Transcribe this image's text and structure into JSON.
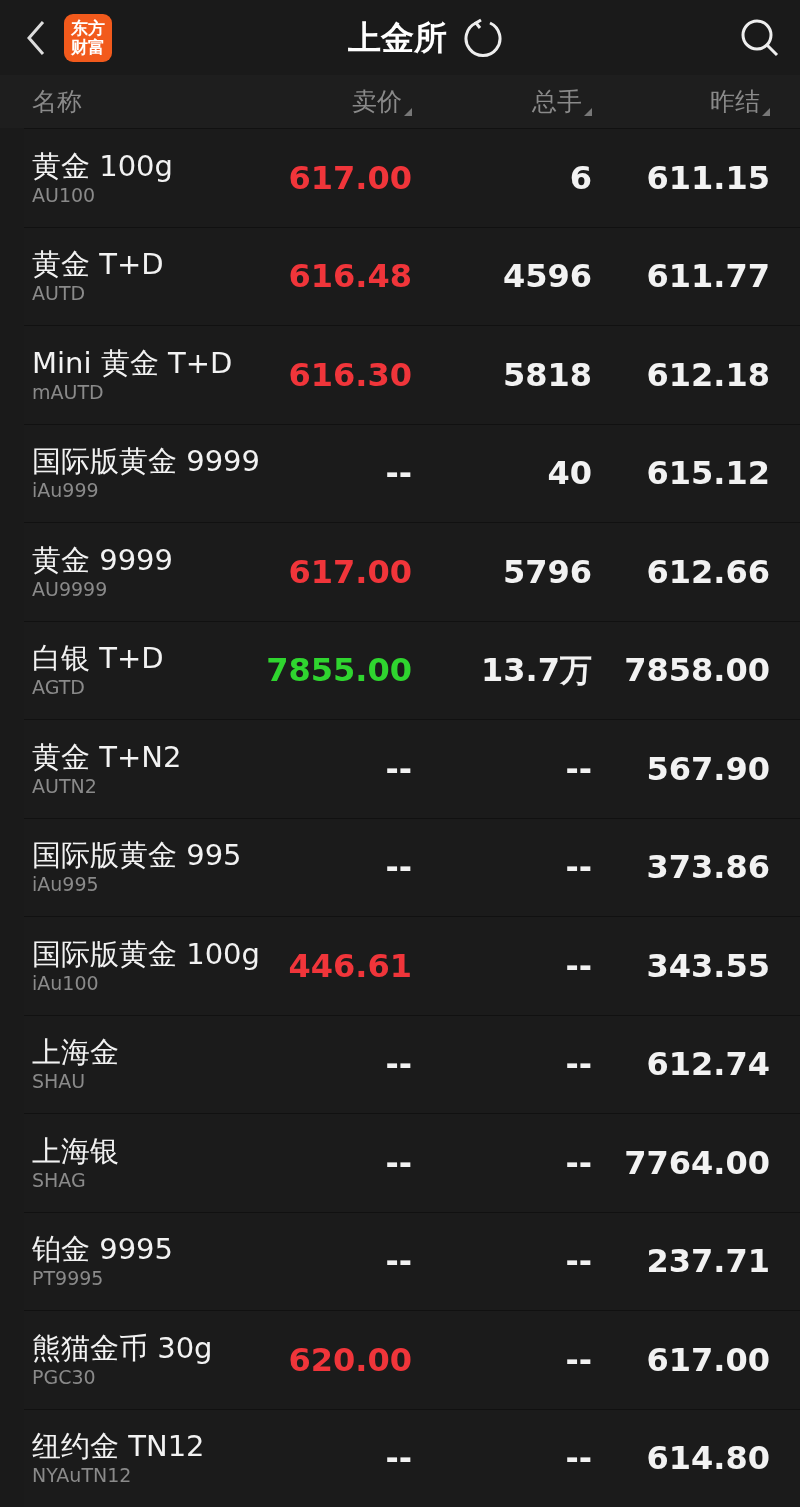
{
  "header": {
    "logo": "东方财富",
    "title": "上金所"
  },
  "table": {
    "columns": [
      {
        "label": "名称",
        "sortable": false
      },
      {
        "label": "卖价",
        "sortable": true
      },
      {
        "label": "总手",
        "sortable": true
      },
      {
        "label": "昨结",
        "sortable": true
      }
    ],
    "rows": [
      {
        "name": "黄金 100g",
        "code": "AU100",
        "price": "617.00",
        "color": "#f0353a",
        "volume": "6",
        "prev": "611.15"
      },
      {
        "name": "黄金 T+D",
        "code": "AUTD",
        "price": "616.48",
        "color": "#f0353a",
        "volume": "4596",
        "prev": "611.77"
      },
      {
        "name": "Mini 黄金 T+D",
        "code": "mAUTD",
        "price": "616.30",
        "color": "#f0353a",
        "volume": "5818",
        "prev": "612.18"
      },
      {
        "name": "国际版黄金 9999",
        "code": "iAu999",
        "price": "--",
        "color": "#f2f2f2",
        "volume": "40",
        "prev": "615.12"
      },
      {
        "name": "黄金 9999",
        "code": "AU9999",
        "price": "617.00",
        "color": "#f0353a",
        "volume": "5796",
        "prev": "612.66"
      },
      {
        "name": "白银 T+D",
        "code": "AGTD",
        "price": "7855.00",
        "color": "#2fd52f",
        "volume": "13.7万",
        "prev": "7858.00"
      },
      {
        "name": "黄金 T+N2",
        "code": "AUTN2",
        "price": "--",
        "color": "#f2f2f2",
        "volume": "--",
        "prev": "567.90"
      },
      {
        "name": "国际版黄金 995",
        "code": "iAu995",
        "price": "--",
        "color": "#f2f2f2",
        "volume": "--",
        "prev": "373.86"
      },
      {
        "name": "国际版黄金 100g",
        "code": "iAu100",
        "price": "446.61",
        "color": "#f0353a",
        "volume": "--",
        "prev": "343.55"
      },
      {
        "name": "上海金",
        "code": "SHAU",
        "price": "--",
        "color": "#f2f2f2",
        "volume": "--",
        "prev": "612.74"
      },
      {
        "name": "上海银",
        "code": "SHAG",
        "price": "--",
        "color": "#f2f2f2",
        "volume": "--",
        "prev": "7764.00"
      },
      {
        "name": "铂金 9995",
        "code": "PT9995",
        "price": "--",
        "color": "#f2f2f2",
        "volume": "--",
        "prev": "237.71"
      },
      {
        "name": "熊猫金币 30g",
        "code": "PGC30",
        "price": "620.00",
        "color": "#f0353a",
        "volume": "--",
        "prev": "617.00"
      },
      {
        "name": "纽约金 TN12",
        "code": "NYAuTN12",
        "price": "--",
        "color": "#f2f2f2",
        "volume": "--",
        "prev": "614.80"
      }
    ]
  }
}
